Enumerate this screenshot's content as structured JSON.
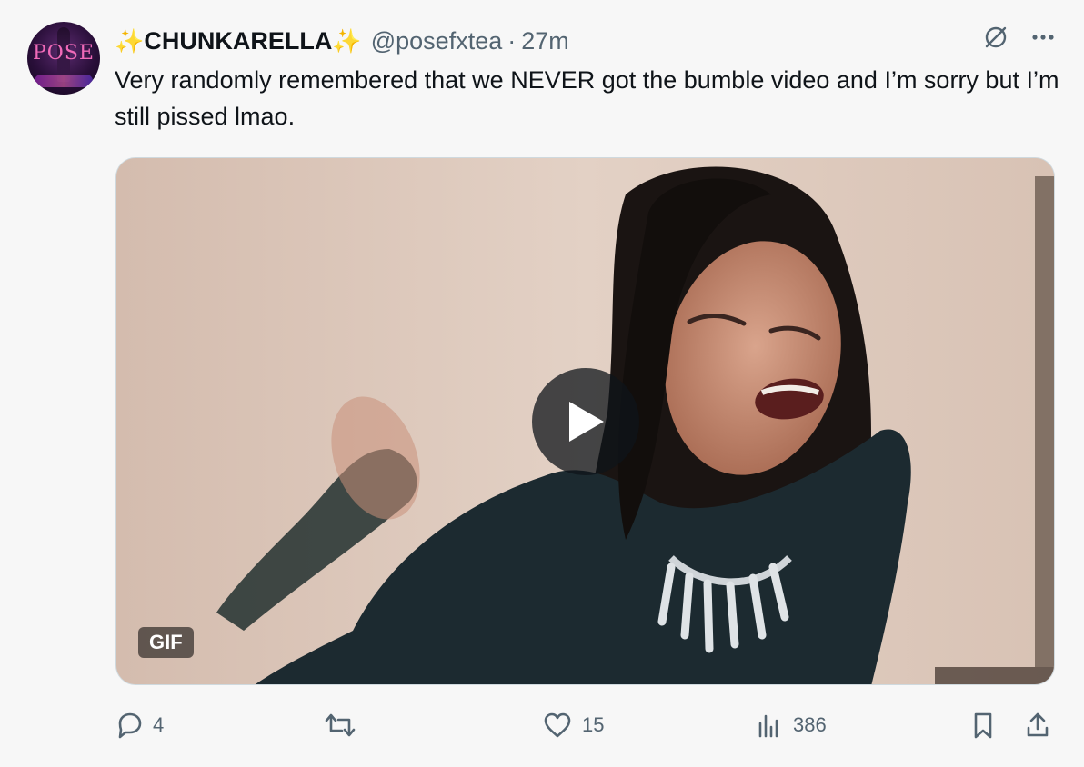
{
  "author": {
    "display_name": "CHUNKARELLA",
    "sparkle_left": "✨",
    "sparkle_right": "✨",
    "handle": "@posefxtea",
    "separator": "·",
    "time": "27m",
    "avatar_text": "POSE"
  },
  "tweet": {
    "text": "Very randomly remembered that we NEVER got the bumble video and I’m sorry but I’m still pissed lmao."
  },
  "media": {
    "badge": "GIF"
  },
  "actions": {
    "replies": "4",
    "reposts": "",
    "likes": "15",
    "views": "386"
  },
  "icons": {
    "grok": "grok-icon",
    "more": "more-icon",
    "reply": "reply-icon",
    "repost": "repost-icon",
    "like": "heart-icon",
    "views": "views-icon",
    "bookmark": "bookmark-icon",
    "share": "share-icon",
    "play": "play-icon"
  },
  "colors": {
    "secondary_text": "#536471",
    "text": "#0f1419",
    "background": "#f7f7f7"
  }
}
